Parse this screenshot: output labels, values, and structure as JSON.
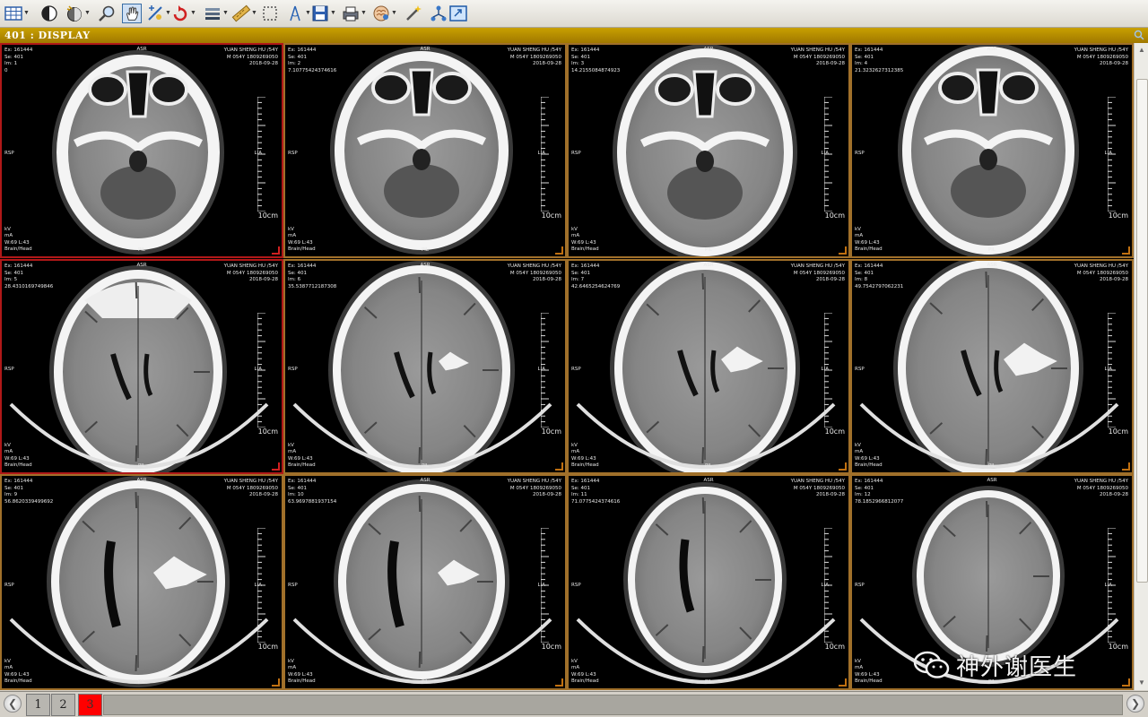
{
  "toolbar": {
    "tools": [
      {
        "name": "layout-grid-icon",
        "has_menu": true
      },
      {
        "name": "window-level-icon",
        "has_menu": false
      },
      {
        "name": "preset-level-icon",
        "has_menu": true
      },
      {
        "name": "zoom-icon",
        "has_menu": false
      },
      {
        "name": "pan-hand-icon",
        "has_menu": false,
        "active": true
      },
      {
        "name": "magnifier-glass-icon",
        "has_menu": true
      },
      {
        "name": "rotate-icon",
        "has_menu": true
      },
      {
        "name": "stack-scroll-icon",
        "has_menu": true
      },
      {
        "name": "ruler-icon",
        "has_menu": true
      },
      {
        "name": "roi-select-icon",
        "has_menu": false
      },
      {
        "name": "angle-icon",
        "has_menu": true
      },
      {
        "name": "save-disk-icon",
        "has_menu": true
      },
      {
        "name": "print-icon",
        "has_menu": true
      },
      {
        "name": "brain-3d-icon",
        "has_menu": true
      },
      {
        "name": "magic-wand-icon",
        "has_menu": false
      },
      {
        "name": "sync-link-icon",
        "has_menu": false
      },
      {
        "name": "fullscreen-icon",
        "has_menu": false
      }
    ]
  },
  "viewport": {
    "title": "401 : DISPLAY"
  },
  "overlay_common": {
    "exam": "Ex: 161444",
    "series": "Se: 401",
    "patient_name": "YUAN SHENG HU /54Y",
    "patient_id": "M 054Y 1809269050",
    "date": "2018-09-28",
    "orient_top": "ASR",
    "orient_bottom": "PIL",
    "orient_left": "RSP",
    "orient_right": "LIA",
    "kv": "kV",
    "ma": "mA",
    "window": "W:69 L:43",
    "protocol": "Brain/Head",
    "scale_label": "10cm"
  },
  "images": [
    {
      "im": "Im: 1",
      "loc": "0",
      "selected": true
    },
    {
      "im": "Im: 2",
      "loc": "7.10775424374616",
      "selected": false
    },
    {
      "im": "Im: 3",
      "loc": "14.2155084874923",
      "selected": false
    },
    {
      "im": "Im: 4",
      "loc": "21.3232627312385",
      "selected": false
    },
    {
      "im": "Im: 5",
      "loc": "28.4310169749846",
      "selected": true
    },
    {
      "im": "Im: 6",
      "loc": "35.5387712187308",
      "selected": false
    },
    {
      "im": "Im: 7",
      "loc": "42.6465254624769",
      "selected": false
    },
    {
      "im": "Im: 8",
      "loc": "49.7542797062231",
      "selected": false
    },
    {
      "im": "Im: 9",
      "loc": "56.8620339499692",
      "selected": false
    },
    {
      "im": "Im: 10",
      "loc": "63.9697881937154",
      "selected": false
    },
    {
      "im": "Im: 11",
      "loc": "71.0775424374616",
      "selected": false
    },
    {
      "im": "Im: 12",
      "loc": "78.1852966812077",
      "selected": false
    }
  ],
  "pager": {
    "pages": [
      "1",
      "2",
      "3"
    ],
    "current": "3"
  },
  "watermark": {
    "text": "神外谢医生"
  }
}
